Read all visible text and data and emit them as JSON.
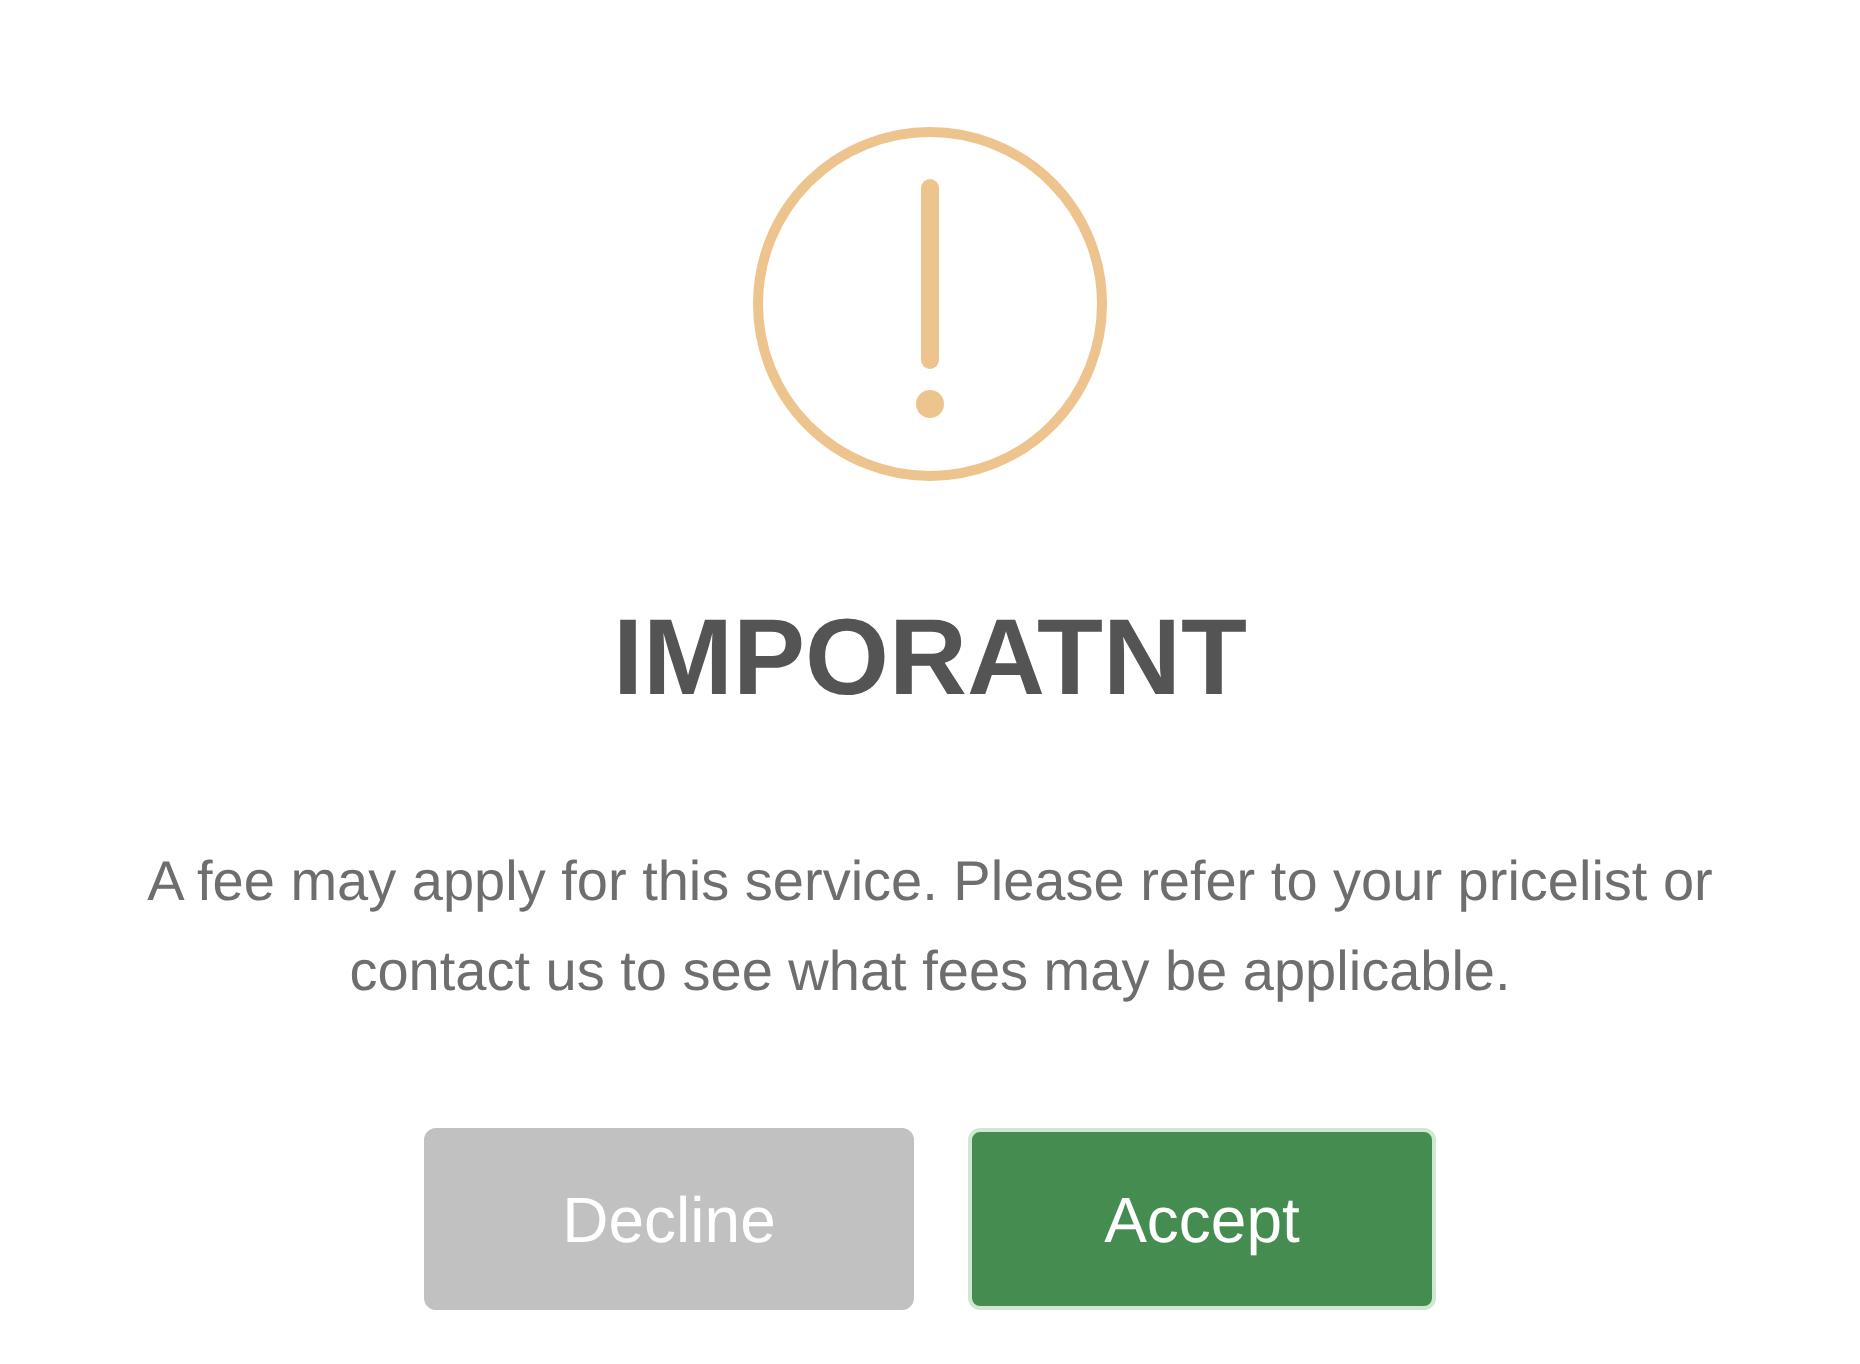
{
  "title": "IMPORATNT",
  "message": "A fee may apply for this service. Please refer to your pricelist or contact us to see what fees may be applicable.",
  "buttons": [
    {
      "label": "Decline",
      "kind": "secondary"
    },
    {
      "label": "Accept",
      "kind": "primary"
    }
  ]
}
